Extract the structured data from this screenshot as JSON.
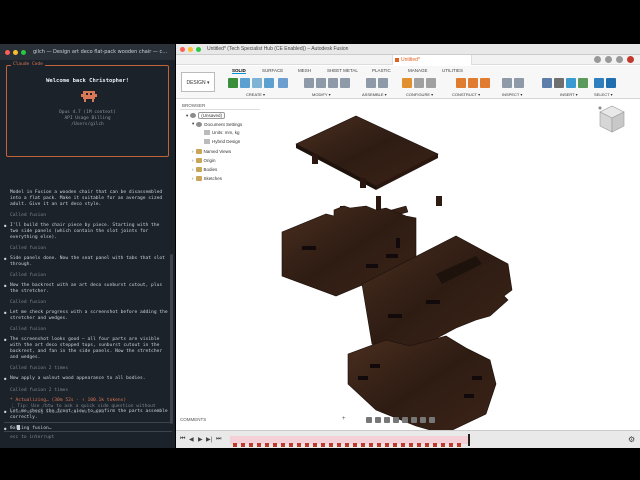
{
  "terminal": {
    "title": "gilch — Design art deco flat-pack wooden chair — c…",
    "welcome_label": "Claude Code",
    "welcome_title": "Welcome back Christopher!",
    "model_line": "Opus 4.7 (1M context)",
    "billing_line": "API Usage Billing",
    "path_line": "/Users/gilch",
    "entries": [
      {
        "kind": "prompt",
        "text": "Model in Fusion a wooden chair that can be disassembled into a flat pack. Make it suitable for an average sized adult. Give it an art deco style."
      },
      {
        "kind": "called",
        "text": "Called fusion"
      },
      {
        "kind": "bullet",
        "text": "I'll build the chair piece by piece. Starting with the two side panels (which contain the slot joints for everything else)."
      },
      {
        "kind": "called",
        "text": "Called fusion"
      },
      {
        "kind": "bullet",
        "text": "Side panels done. Now the seat panel with tabs that slot through."
      },
      {
        "kind": "called",
        "text": "Called fusion"
      },
      {
        "kind": "bullet",
        "text": "Now the backrest with an art deco sunburst cutout, plus the stretcher."
      },
      {
        "kind": "called",
        "text": "Called fusion"
      },
      {
        "kind": "bullet",
        "text": "Let me check progress with a screenshot before adding the stretcher and wedges."
      },
      {
        "kind": "called",
        "text": "Called fusion"
      },
      {
        "kind": "bullet",
        "text": "The screenshot looks good — all four parts are visible with the art deco stepped tops, sunburst cutout in the backrest, and fan in the side panels. Now the stretcher and wedges."
      },
      {
        "kind": "called",
        "text": "Called fusion 2 times"
      },
      {
        "kind": "bullet",
        "text": "Now apply a walnut wood appearance to all bodies."
      },
      {
        "kind": "called",
        "text": "Called fusion 2 times"
      },
      {
        "kind": "bullet",
        "text": "Let me check the front view to confirm the parts assemble correctly."
      },
      {
        "kind": "bullet",
        "text": "Calling fusion…"
      }
    ],
    "status_main": "* Actualizing… (30m 52s · ↑ 100.1k tokens)",
    "status_tip": "⎿ Tip: Use /btw to ask a quick side question without interrupting Claude's current work",
    "input_caret": ">",
    "hint": "esc to interrupt"
  },
  "fusion": {
    "window_title": "Untitled* (Tech Specialist Hub (CE Enabled)) – Autodesk Fusion",
    "doc_tab": "Untitled*",
    "design_button": "DESIGN ▾",
    "ribbon_tabs": [
      "SOLID",
      "SURFACE",
      "MESH",
      "SHEET METAL",
      "PLASTIC",
      "MANAGE",
      "UTILITIES"
    ],
    "active_tab": "SOLID",
    "groups": [
      "CREATE ▾",
      "MODIFY ▾",
      "ASSEMBLE ▾",
      "CONFIGURE ▾",
      "CONSTRUCT ▾",
      "INSPECT ▾",
      "INSERT ▾",
      "SELECT ▾"
    ],
    "browser_title": "BROWSER",
    "tree": [
      "(Unsaved)",
      "Document Settings",
      "Units: mm, kg",
      "Hybrid Design",
      "Named Views",
      "Origin",
      "Bodies",
      "Sketches"
    ],
    "comments": "COMMENTS",
    "comments_plus": "+",
    "timeline_controls": [
      "⏮",
      "◀",
      "▶",
      "▶|",
      "⏭"
    ],
    "gear": "⚙",
    "colors": {
      "accent": "#0696d7",
      "wood_dark": "#2a1a12",
      "wood_mid": "#3b2418",
      "wood_light": "#5a3a28",
      "doc_tab": "#e06020",
      "timeline": "#f5d0d6"
    }
  }
}
